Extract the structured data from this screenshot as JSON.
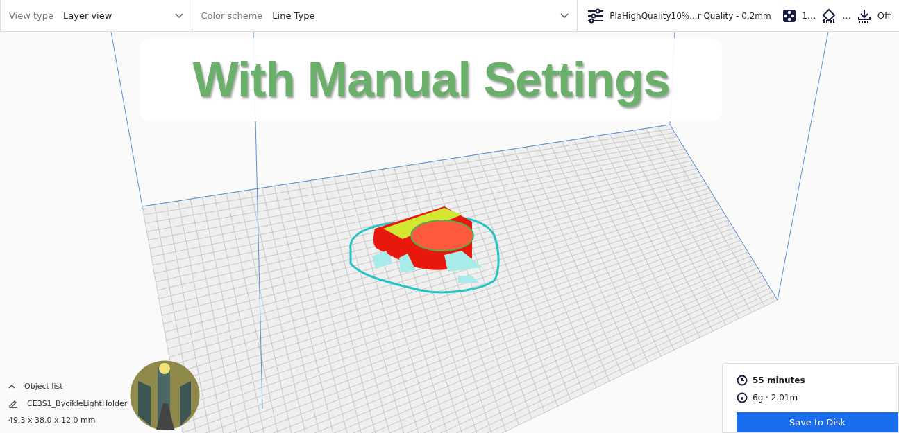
{
  "view_type": {
    "label": "View type",
    "value": "Layer view"
  },
  "color_scheme": {
    "label": "Color scheme",
    "value": "Line Type"
  },
  "print_settings": {
    "profile": "PlaHighQuality10%...r Quality - 0.2mm",
    "infill": "1...",
    "support": "...",
    "adhesion": "Off"
  },
  "banner": {
    "text": "With Manual Settings"
  },
  "object_list": {
    "title": "Object list",
    "objects": [
      {
        "name": "CE3S1_BycikleLightHolder"
      }
    ],
    "dimensions": "49.3 x 38.0 x 12.0 mm"
  },
  "print_summary": {
    "time": "55 minutes",
    "material": "6g · 2.01m",
    "action": "Save to Disk"
  }
}
